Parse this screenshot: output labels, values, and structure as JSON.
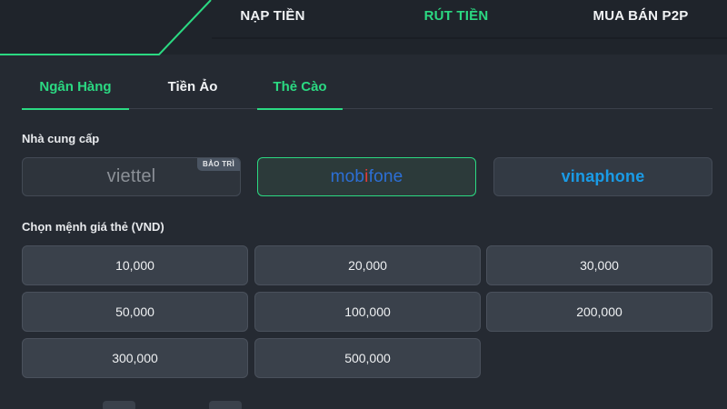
{
  "top_tabs": [
    {
      "label": "NẠP TIỀN",
      "active": false
    },
    {
      "label": "RÚT TIỀN",
      "active": true
    },
    {
      "label": "MUA BÁN P2P",
      "active": false
    }
  ],
  "sub_tabs": [
    {
      "label": "Ngân Hàng",
      "color": "#2bd982",
      "underline": true
    },
    {
      "label": "Tiền Ảo",
      "color": "#f1f3f5",
      "underline": false
    },
    {
      "label": "Thẻ Cào",
      "color": "#2bd982",
      "underline": true
    }
  ],
  "provider_section": {
    "label": "Nhà cung cấp",
    "providers": [
      {
        "name": "viettel",
        "state": "disabled",
        "badge": "BẢO TRÌ"
      },
      {
        "name_part1": "mob",
        "name_part2": "i",
        "name_part3": "fone",
        "state": "selected"
      },
      {
        "name": "vinaphone",
        "state": "normal"
      }
    ]
  },
  "denomination_section": {
    "label": "Chọn mệnh giá thẻ (VND)",
    "values": [
      "10,000",
      "20,000",
      "30,000",
      "50,000",
      "100,000",
      "200,000",
      "300,000",
      "500,000"
    ]
  },
  "colors": {
    "accent": "#2bd982",
    "background": "#252a32",
    "header": "#1f242b",
    "tile": "#3a414b"
  }
}
